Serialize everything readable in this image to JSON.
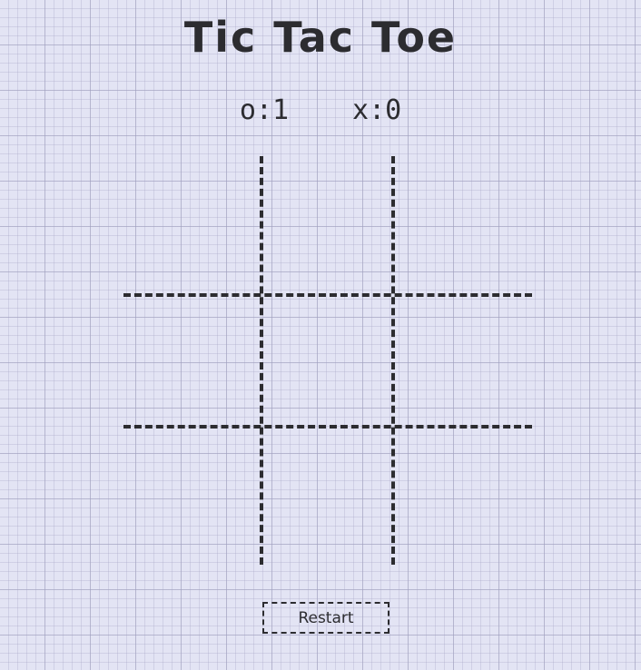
{
  "game": {
    "title": "Tic Tac Toe",
    "score": {
      "o_label": "o",
      "o_value": "1",
      "x_label": "x",
      "x_value": "0",
      "separator": ":"
    },
    "board": [
      "",
      "",
      "",
      "",
      "",
      "",
      "",
      "",
      ""
    ],
    "restart_label": "Restart"
  },
  "colors": {
    "ink": "#2c2c30",
    "paper": "#e3e4f4",
    "grid": "#a0a0be"
  }
}
